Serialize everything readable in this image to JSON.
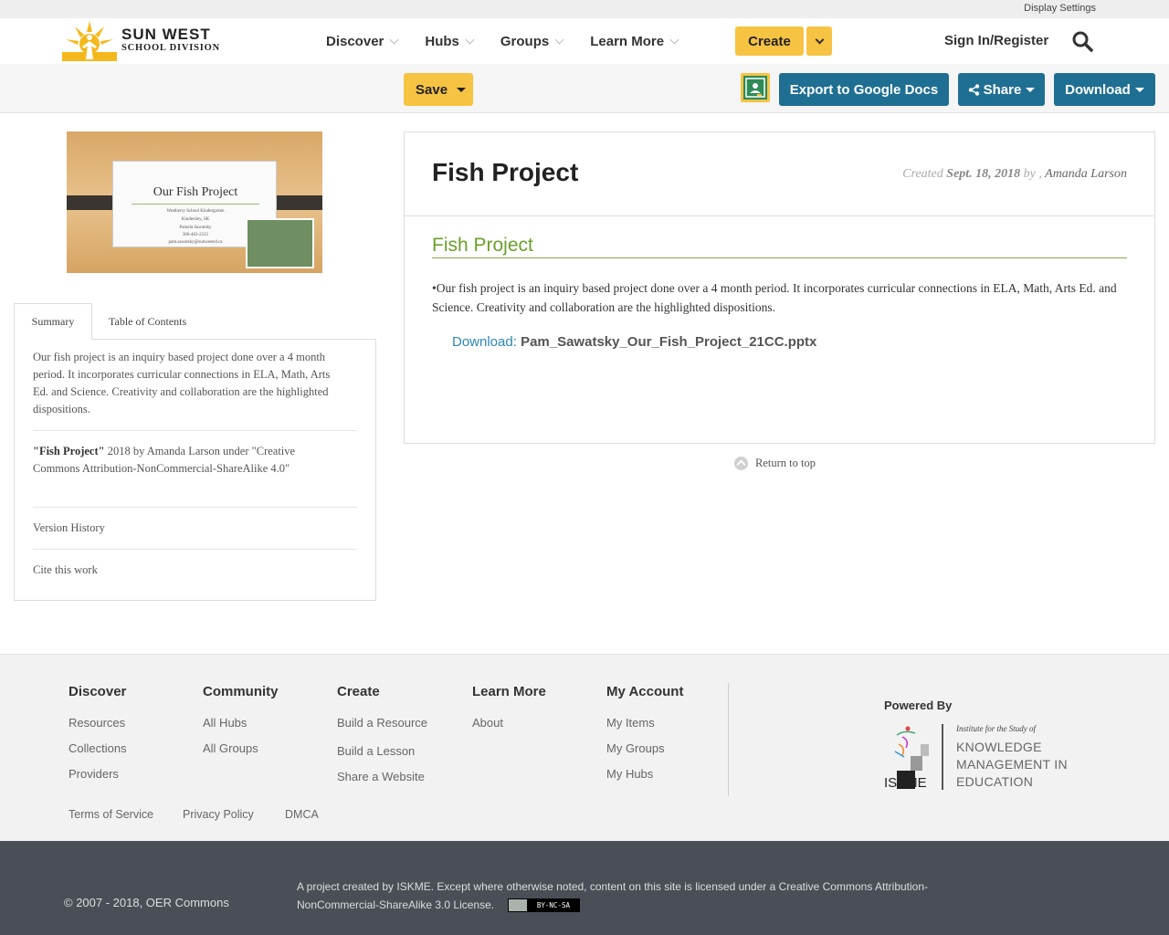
{
  "top_strip": {
    "display_settings": "Display Settings"
  },
  "brand": {
    "line1": "SUN WEST",
    "line2": "SCHOOL DIVISION"
  },
  "nav": {
    "items": [
      "Discover",
      "Hubs",
      "Groups",
      "Learn More"
    ],
    "create_label": "Create",
    "signin_label": "Sign In/Register"
  },
  "toolbar": {
    "save_label": "Save",
    "export_label": "Export to Google Docs",
    "share_label": "Share",
    "download_label": "Download"
  },
  "thumbnail": {
    "title": "Our Fish Project",
    "line1": "Westberry School Kindergarten",
    "line2": "Kindersley, SK",
    "line3": "Pamela Sawatsky",
    "line4": "306-463-2315",
    "line5": "pam.sawatsky@sunwestsd.ca"
  },
  "tabs": {
    "summary": "Summary",
    "toc": "Table of Contents"
  },
  "summary": {
    "text": "Our fish project is an inquiry based project done over a 4 month period. It incorporates curricular connections in ELA, Math, Arts Ed. and Science. Creativity and collaboration are the highlighted dispositions.",
    "attr_title": "\"Fish Project\"",
    "attr_rest": " 2018 by Amanda Larson under \"Creative Commons Attribution-NonCommercial-ShareAlike 4.0\"",
    "version_history": "Version History",
    "cite": "Cite this work"
  },
  "resource": {
    "title": "Fish Project",
    "created_prefix": "Created ",
    "created_date": "Sept. 18, 2018",
    "created_by": " by , ",
    "author": "Amanda Larson",
    "section_title": "Fish Project",
    "body": "•Our fish project is an inquiry based project done over a 4 month period. It incorporates curricular connections in ELA, Math, Arts Ed. and Science. Creativity and collaboration are the highlighted dispositions.",
    "download_label": "Download:",
    "download_file": "Pam_Sawatsky_Our_Fish_Project_21CC.pptx"
  },
  "return_top": "Return to top",
  "footer": {
    "cols": [
      {
        "head": "Discover",
        "links": [
          "Resources",
          "Collections",
          "Providers"
        ]
      },
      {
        "head": "Community",
        "links": [
          "All Hubs",
          "All Groups"
        ]
      },
      {
        "head": "Create",
        "links": [
          "Build a Resource",
          "Build a Lesson",
          "Share a Website"
        ]
      },
      {
        "head": "Learn More",
        "links": [
          "About"
        ]
      },
      {
        "head": "My Account",
        "links": [
          "My Items",
          "My Groups",
          "My Hubs"
        ]
      }
    ],
    "powered_by": "Powered By",
    "iskme_small": "Institute for the Study of",
    "iskme_l1": "KNOWLEDGE",
    "iskme_l2": "MANAGEMENT IN",
    "iskme_l3": "EDUCATION",
    "iskme_word": "ISKME",
    "legal": [
      "Terms of Service",
      "Privacy Policy",
      "DMCA"
    ]
  },
  "bottom": {
    "copyright": "© 2007 - 2018, OER Commons",
    "license": "A project created by ISKME. Except where otherwise noted, content on this site is licensed under a Creative Commons Attribution-NonCommercial-ShareAlike 3.0 License.",
    "cc_label": "BY-NC-SA"
  },
  "colors": {
    "accent_yellow": "#f6c343",
    "button_blue": "#1f6f93",
    "section_green": "#6aa02a",
    "footer_dark": "#4a4f57"
  }
}
